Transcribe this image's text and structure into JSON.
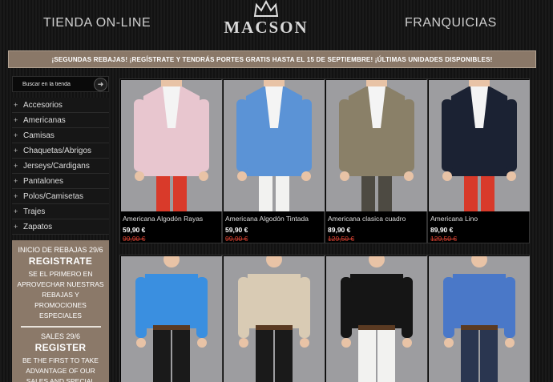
{
  "header": {
    "nav_left": "TIENDA ON-LINE",
    "nav_right": "FRANQUICIAS",
    "logo_text": "MACSON"
  },
  "banner": {
    "text": "¡SEGUNDAS REBAJAS! ¡REGÍSTRATE Y TENDRÁS PORTES GRATIS HASTA EL 15 DE SEPTIEMBRE! ¡ÚLTIMAS UNIDADES DISPONIBLES!"
  },
  "search": {
    "placeholder": "Buscar en la tienda",
    "button_icon": "arrow-right-icon"
  },
  "categories": [
    "Accesorios",
    "Americanas",
    "Camisas",
    "Chaquetas/Abrigos",
    "Jerseys/Cardigans",
    "Pantalones",
    "Polos/Camisetas",
    "Trajes",
    "Zapatos"
  ],
  "promo_es": {
    "date": "INICIO DE REBAJAS 29/6",
    "title": "REGISTRATE",
    "text": "SE EL PRIMERO EN APROVECHAR NUESTRAS REBAJAS Y PROMOCIONES ESPECIALES"
  },
  "promo_en": {
    "date": "SALES 29/6",
    "title": "REGISTER",
    "text": "BE THE FIRST TO TAKE ADVANTAGE OF OUR SALES AND SPECIAL"
  },
  "products": [
    {
      "name": "Americana Algodón Rayas",
      "price": "59,90 €",
      "old_price": "99,90 €",
      "jacket": "#e8c6cf",
      "shirt": "#f4f4f4",
      "pants": "#d93a2a"
    },
    {
      "name": "Americana Algodón Tintada",
      "price": "59,90 €",
      "old_price": "99,90 €",
      "jacket": "#5b93d6",
      "shirt": "#f4f4f4",
      "pants": "#f2f2f0"
    },
    {
      "name": "Americana clasica cuadro",
      "price": "89,90 €",
      "old_price": "129,50 €",
      "jacket": "#8a8068",
      "shirt": "#f4f4f4",
      "pants": "#4d4a42"
    },
    {
      "name": "Americana Lino",
      "price": "89,90 €",
      "old_price": "129,50 €",
      "jacket": "#1b2233",
      "shirt": "#f4f4f4",
      "pants": "#d83a2a"
    }
  ],
  "products_row2": [
    {
      "shirt": "#3a8fe0",
      "pants": "#1a1a1a"
    },
    {
      "shirt": "#d9cbb4",
      "pants": "#1a1a1a"
    },
    {
      "shirt": "#151515",
      "pants": "#f2f2f0"
    },
    {
      "shirt": "#4a78c8",
      "pants": "#2a3650"
    }
  ],
  "colors": {
    "banner_bg": "#8a7868",
    "promo_bg": "#8b7969",
    "old_price": "#d04030"
  }
}
